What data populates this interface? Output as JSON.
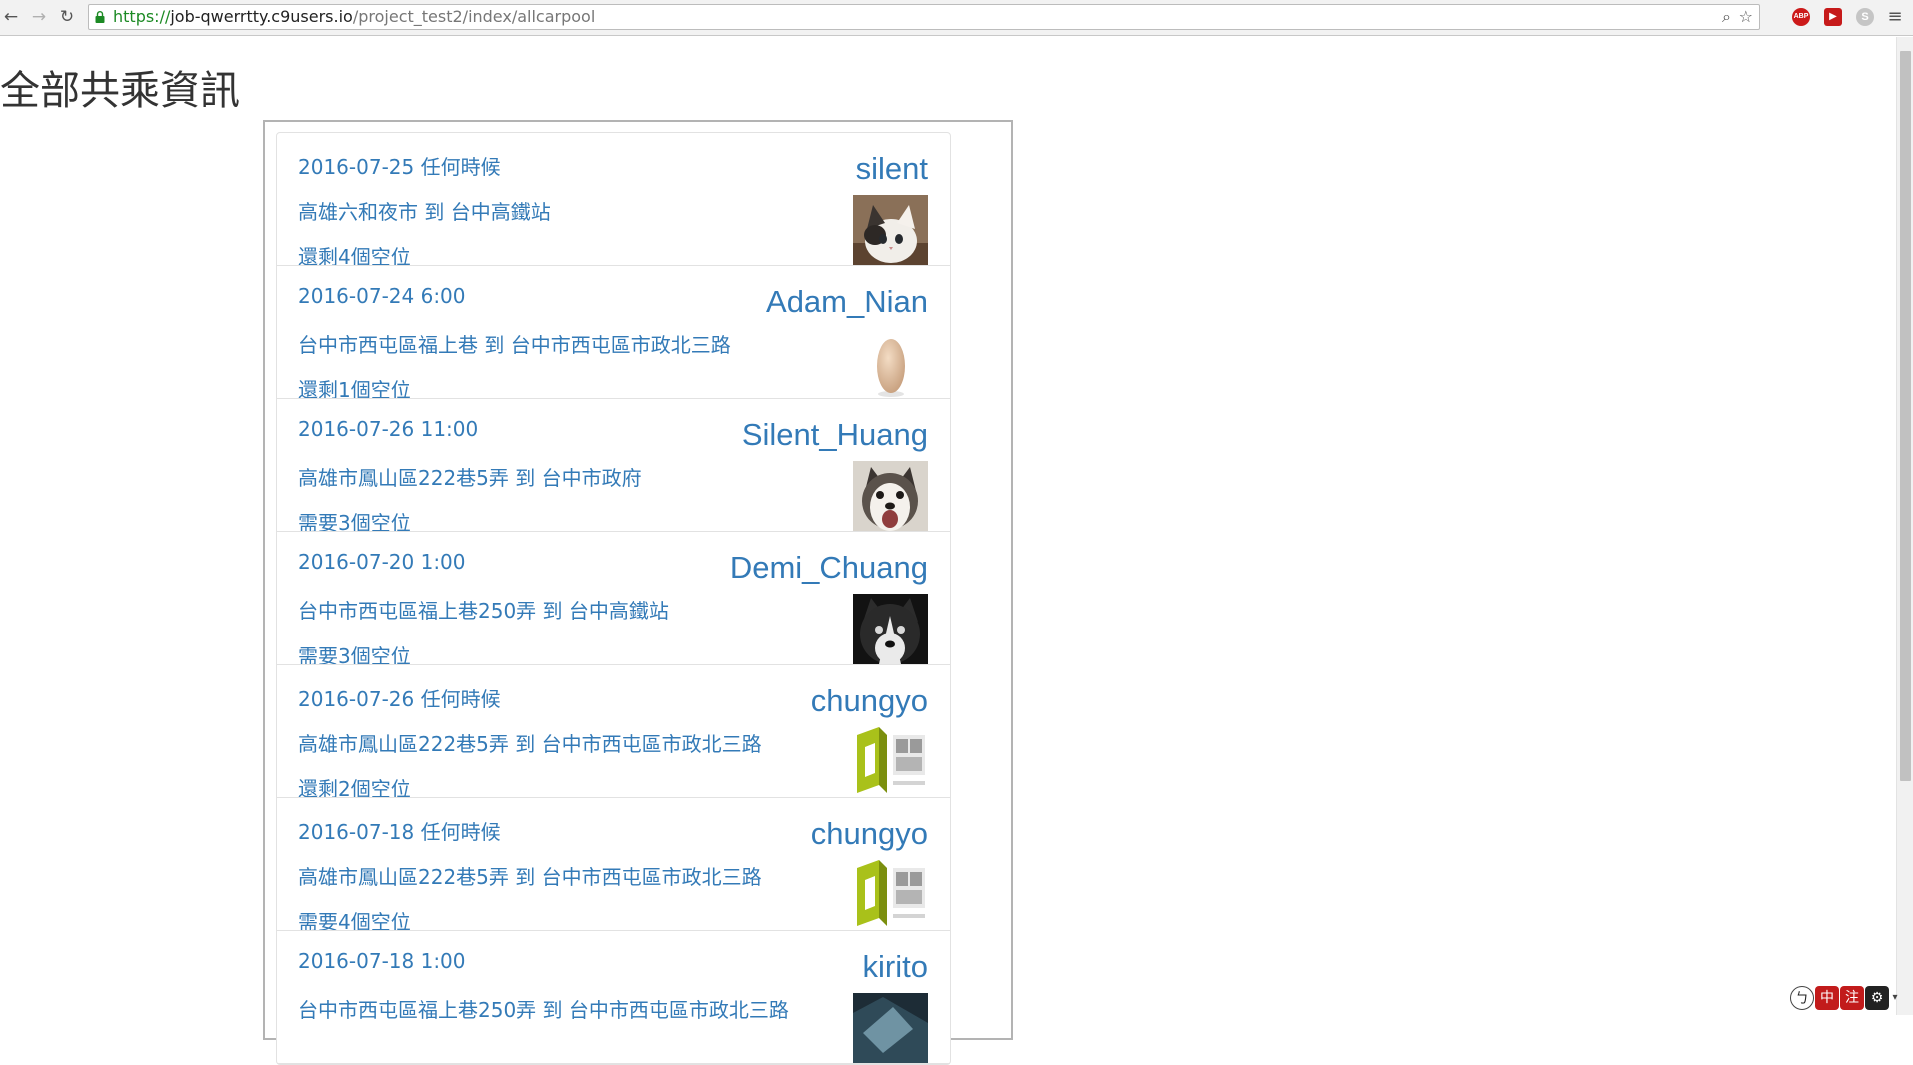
{
  "browser": {
    "url_scheme": "https://",
    "url_host": "job-qwerrtty.c9users.io",
    "url_path": "/project_test2/index/allcarpool",
    "extensions": [
      "ABP",
      "▶",
      "S"
    ]
  },
  "page": {
    "title": "全部共乘資訊"
  },
  "carpools": [
    {
      "date": "2016-07-25 任何時候",
      "route": "高雄六和夜市 到 台中高鐵站",
      "seats": "還剩4個空位",
      "user": "silent",
      "avatar": "cat-photo"
    },
    {
      "date": "2016-07-24 6:00",
      "route": "台中市西屯區福上巷 到 台中市西屯區市政北三路",
      "seats": "還剩1個空位",
      "user": "Adam_Nian",
      "avatar": "egg-photo"
    },
    {
      "date": "2016-07-26 11:00",
      "route": "高雄市鳳山區222巷5弄 到 台中市政府",
      "seats": "需要3個空位",
      "user": "Silent_Huang",
      "avatar": "husky-photo"
    },
    {
      "date": "2016-07-20 1:00",
      "route": "台中市西屯區福上巷250弄 到 台中高鐵站",
      "seats": "需要3個空位",
      "user": "Demi_Chuang",
      "avatar": "husky-dark-photo"
    },
    {
      "date": "2016-07-26 任何時候",
      "route": "高雄市鳳山區222巷5弄 到 台中市西屯區市政北三路",
      "seats": "還剩2個空位",
      "user": "chungyo",
      "avatar": "logo-image"
    },
    {
      "date": "2016-07-18 任何時候",
      "route": "高雄市鳳山區222巷5弄 到 台中市西屯區市政北三路",
      "seats": "需要4個空位",
      "user": "chungyo",
      "avatar": "logo-image"
    },
    {
      "date": "2016-07-18 1:00",
      "route": "台中市西屯區福上巷250弄 到 台中市西屯區市政北三路",
      "seats": "",
      "user": "kirito",
      "avatar": "dark-photo"
    }
  ],
  "ime": {
    "mode": "ㄅ",
    "lang": "中",
    "punct": "注",
    "tool": "⚙",
    "arrow": "▾"
  },
  "colors": {
    "link": "#337ab7",
    "title": "#333333",
    "frame_border": "#b3b3b3"
  }
}
